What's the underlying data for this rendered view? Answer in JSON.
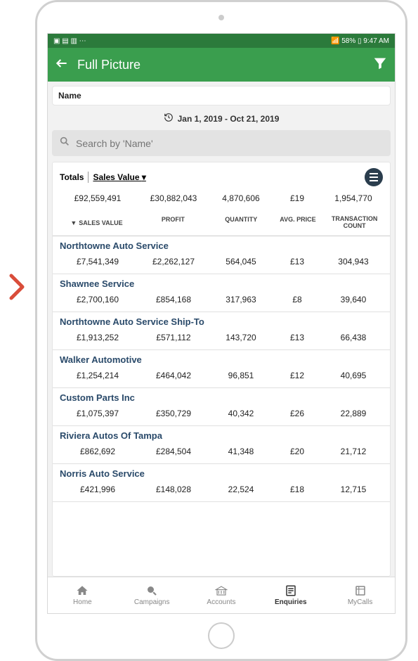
{
  "status": {
    "left": "▣ ▤ ▥ ⋯",
    "battery": "58%",
    "time": "9:47 AM"
  },
  "appbar": {
    "title": "Full Picture"
  },
  "nameCard": "Name",
  "dateRange": "Jan 1, 2019 - Oct 21, 2019",
  "search": {
    "placeholder": "Search by 'Name'"
  },
  "totals": {
    "label": "Totals",
    "sortBy": "Sales Value",
    "values": {
      "sales": "£92,559,491",
      "profit": "£30,882,043",
      "qty": "4,870,606",
      "avg": "£19",
      "trans": "1,954,770"
    }
  },
  "columns": {
    "c0": "SALES VALUE",
    "c1": "PROFIT",
    "c2": "QUANTITY",
    "c3": "AVG. PRICE",
    "c4a": "TRANSACTION",
    "c4b": "COUNT"
  },
  "rows": [
    {
      "name": "Northtowne Auto Service",
      "sales": "£7,541,349",
      "profit": "£2,262,127",
      "qty": "564,045",
      "avg": "£13",
      "trans": "304,943"
    },
    {
      "name": "Shawnee Service",
      "sales": "£2,700,160",
      "profit": "£854,168",
      "qty": "317,963",
      "avg": "£8",
      "trans": "39,640"
    },
    {
      "name": "Northtowne Auto Service Ship-To",
      "sales": "£1,913,252",
      "profit": "£571,112",
      "qty": "143,720",
      "avg": "£13",
      "trans": "66,438"
    },
    {
      "name": "Walker Automotive",
      "sales": "£1,254,214",
      "profit": "£464,042",
      "qty": "96,851",
      "avg": "£12",
      "trans": "40,695"
    },
    {
      "name": "Custom Parts Inc",
      "sales": "£1,075,397",
      "profit": "£350,729",
      "qty": "40,342",
      "avg": "£26",
      "trans": "22,889"
    },
    {
      "name": "Riviera Autos Of Tampa",
      "sales": "£862,692",
      "profit": "£284,504",
      "qty": "41,348",
      "avg": "£20",
      "trans": "21,712"
    },
    {
      "name": "Norris Auto Service",
      "sales": "£421,996",
      "profit": "£148,028",
      "qty": "22,524",
      "avg": "£18",
      "trans": "12,715"
    }
  ],
  "nav": {
    "home": "Home",
    "campaigns": "Campaigns",
    "accounts": "Accounts",
    "enquiries": "Enquiries",
    "mycalls": "MyCalls"
  }
}
